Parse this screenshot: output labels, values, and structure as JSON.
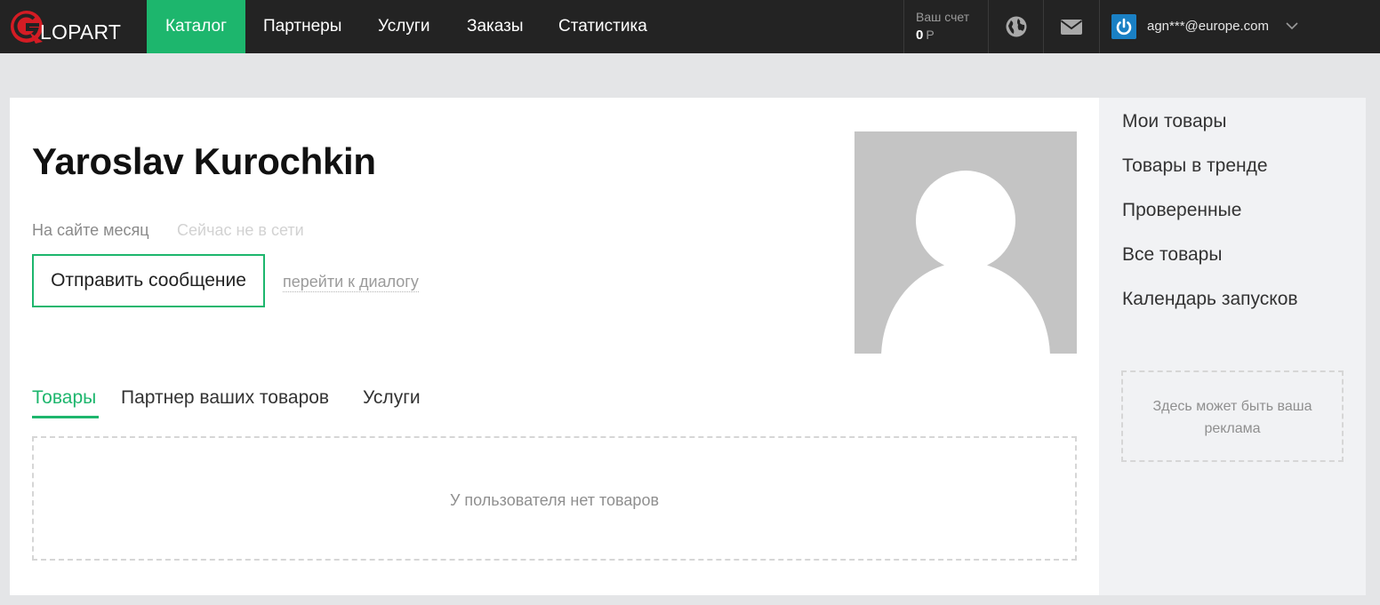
{
  "brand": {
    "logo_letter": "G",
    "logo_text": "LOPART",
    "accent": "#1db66d",
    "logo_red": "#d41c24"
  },
  "nav": {
    "items": [
      {
        "label": "Каталог",
        "active": true
      },
      {
        "label": "Партнеры",
        "active": false
      },
      {
        "label": "Услуги",
        "active": false
      },
      {
        "label": "Заказы",
        "active": false
      },
      {
        "label": "Статистика",
        "active": false
      }
    ]
  },
  "account": {
    "balance_label": "Ваш счет",
    "balance_value": "0",
    "currency": "Р"
  },
  "header_icons": [
    "globe-icon",
    "mail-icon",
    "power-icon",
    "chevron-down-icon"
  ],
  "user": {
    "email": "agn***@europe.com"
  },
  "profile": {
    "name": "Yaroslav Kurochkin",
    "on_site": "На сайте месяц",
    "status": "Сейчас не в сети",
    "send_message": "Отправить сообщение",
    "go_to_dialog": "перейти к диалогу"
  },
  "tabs": [
    {
      "label": "Товары",
      "active": true
    },
    {
      "label": "Партнер ваших товаров",
      "active": false
    },
    {
      "label": "Услуги",
      "active": false
    }
  ],
  "empty_state": "У пользователя нет товаров",
  "sidebar": {
    "links": [
      {
        "label": "Мои товары"
      },
      {
        "label": "Товары в тренде"
      },
      {
        "label": "Проверенные"
      },
      {
        "label": "Все товары"
      },
      {
        "label": "Календарь запусков"
      }
    ],
    "ad_text": "Здесь может быть ваша реклама"
  }
}
